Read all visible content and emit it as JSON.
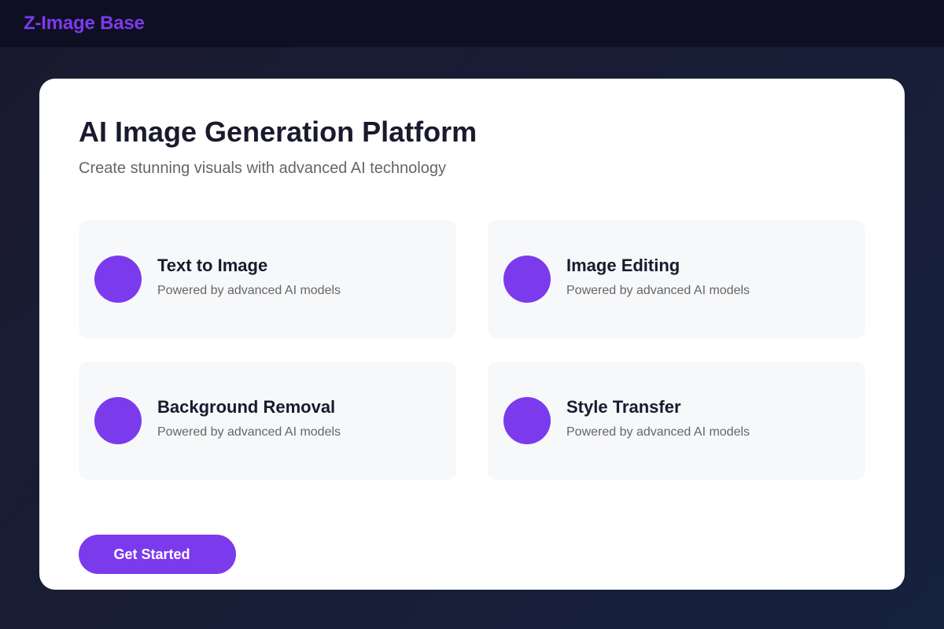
{
  "header": {
    "brand": "Z-Image Base"
  },
  "main": {
    "title": "AI Image Generation Platform",
    "subtitle": "Create stunning visuals with advanced AI technology",
    "features": [
      {
        "title": "Text to Image",
        "description": "Powered by advanced AI models",
        "icon": "circle-icon"
      },
      {
        "title": "Image Editing",
        "description": "Powered by advanced AI models",
        "icon": "circle-icon"
      },
      {
        "title": "Background Removal",
        "description": "Powered by advanced AI models",
        "icon": "circle-icon"
      },
      {
        "title": "Style Transfer",
        "description": "Powered by advanced AI models",
        "icon": "circle-icon"
      }
    ],
    "cta_label": "Get Started"
  },
  "colors": {
    "accent": "#7c3aed",
    "page_background": "#1a1a2e",
    "header_background": "#0f0f23",
    "card_background": "#ffffff",
    "feature_background": "#f7f8fa",
    "heading_text": "#1a1a2e",
    "muted_text": "#666666"
  }
}
